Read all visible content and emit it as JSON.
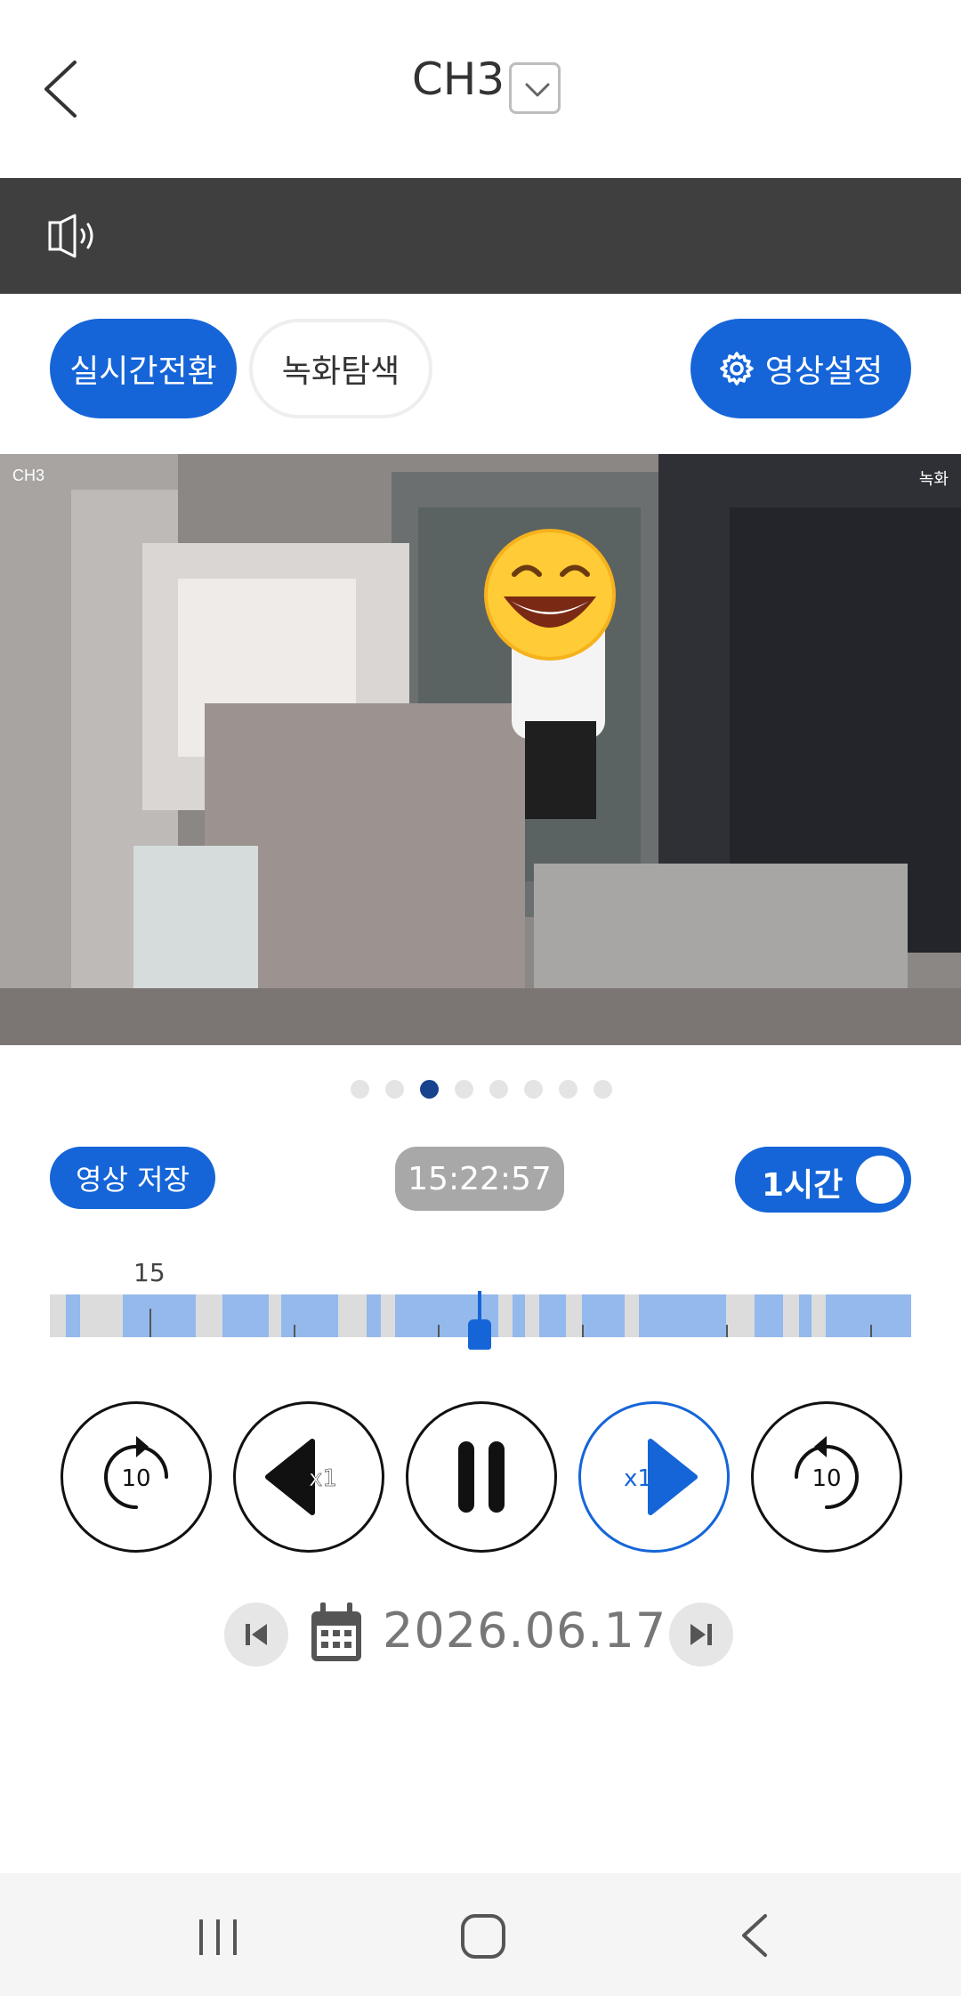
{
  "header": {
    "title": "CH3",
    "back_icon": "chevron-left-icon",
    "dropdown_icon": "chevron-down-icon"
  },
  "audio": {
    "speaker_icon": "speaker-icon"
  },
  "mode_buttons": {
    "live_label": "실시간전환",
    "record_search_label": "녹화탐색",
    "settings_label": "영상설정",
    "settings_icon": "gear-icon"
  },
  "video": {
    "channel_label": "CH3",
    "overlay_label": "녹화"
  },
  "pager": {
    "count": 8,
    "active_index": 2
  },
  "playback": {
    "save_label": "영상 저장",
    "current_time": "15:22:57",
    "range_label": "1시간",
    "range_toggle_on": true
  },
  "timeline": {
    "hour_label": "15"
  },
  "controls": {
    "rewind_seconds": "10",
    "reverse_speed": "x1",
    "forward_speed": "x1",
    "forward_seconds": "10"
  },
  "date": {
    "value": "2026.06.17"
  },
  "colors": {
    "accent": "#1565d8",
    "audio_bar": "#3f3f3f",
    "timeline_recorded": "#94b9ec",
    "timeline_empty": "#dcdcdc"
  }
}
